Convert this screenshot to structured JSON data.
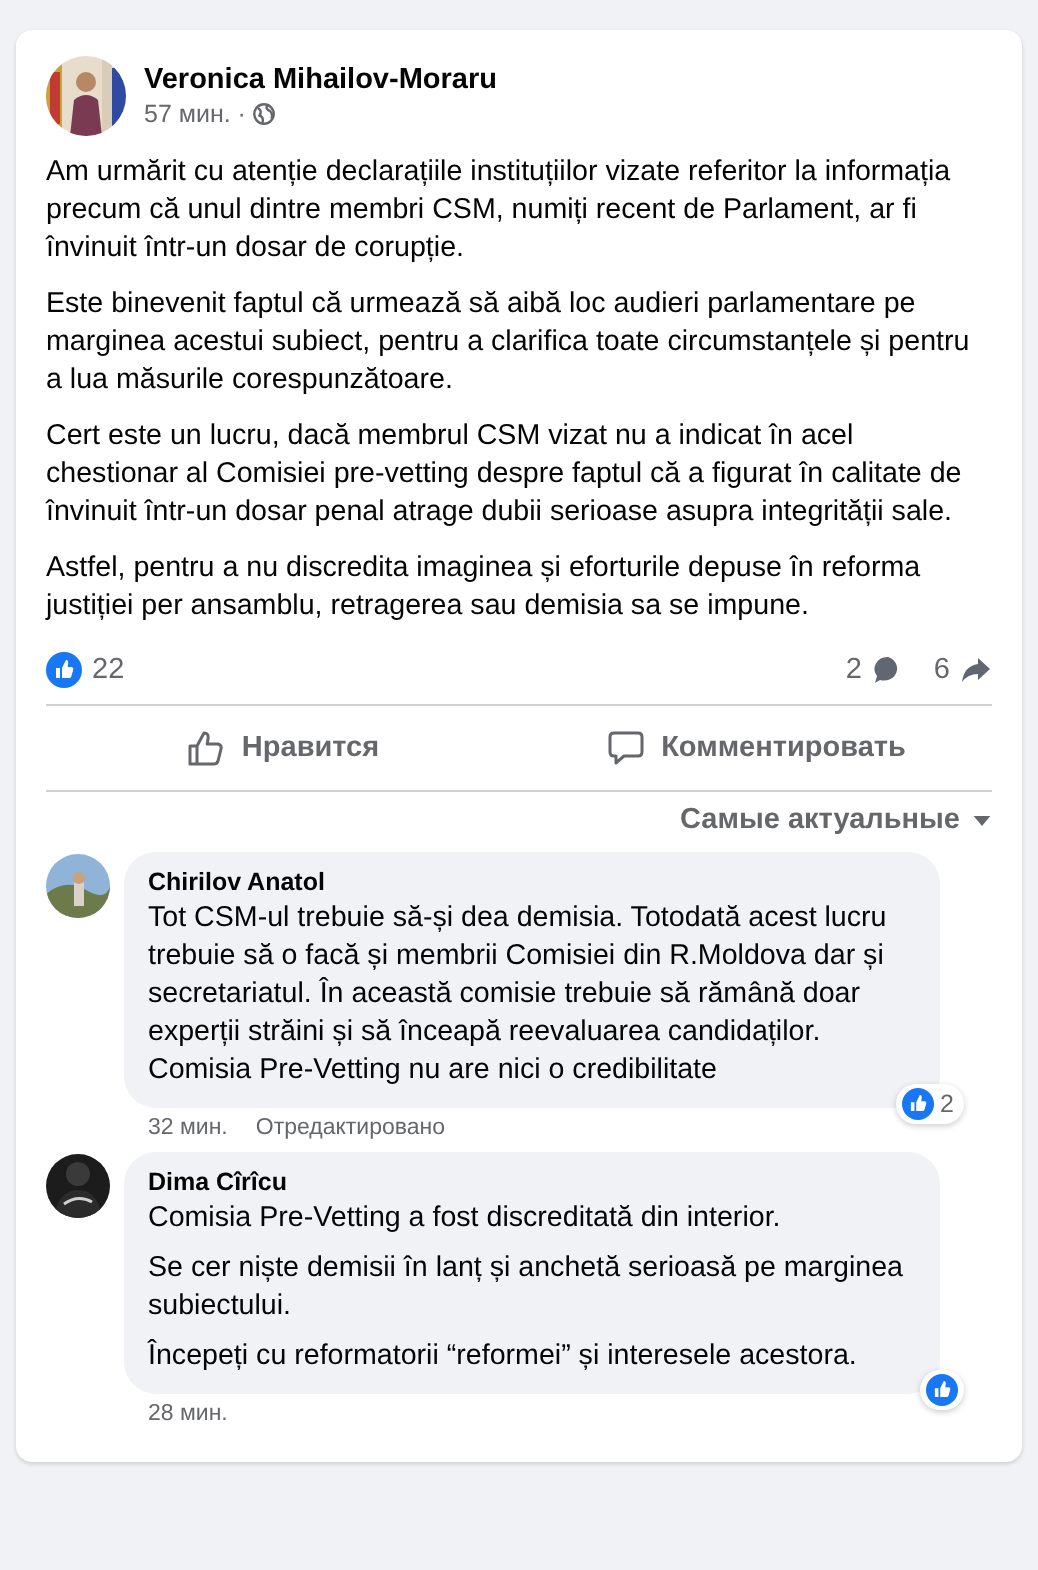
{
  "post": {
    "author": "Veronica Mihailov-Moraru",
    "time": "57 мин. ·",
    "paragraphs": [
      "Am urmărit cu atenție declarațiile instituțiilor vizate referitor la informația precum că unul dintre membri CSM, numiți recent de Parlament, ar fi învinuit într-un dosar de corupție.",
      "Este binevenit faptul că urmează să aibă loc audieri parlamentare pe marginea acestui subiect, pentru a clarifica toate circumstanțele și pentru a lua măsurile corespunzătoare.",
      "Cert este un lucru, dacă membrul CSM vizat nu a indicat în acel chestionar al Comisiei pre-vetting despre faptul că a figurat în calitate de învinuit într-un dosar penal atrage dubii serioase asupra integrității sale.",
      "Astfel, pentru a nu discredita imaginea și eforturile depuse în reforma justiției per ansamblu, retragerea sau demisia sa se impune."
    ],
    "reactions": "22",
    "comments_count": "2",
    "shares_count": "6"
  },
  "actions": [
    {
      "kind": "like",
      "label": "Нравится"
    },
    {
      "kind": "comment",
      "label": "Комментировать"
    }
  ],
  "sort": "Самые актуальные",
  "comments": [
    {
      "author": "Chirilov Anatol",
      "paragraphs": [
        "Tot CSM-ul trebuie să-și dea demisia. Totodată acest lucru trebuie să o facă și membrii Comisiei din R.Moldova dar și secretariatul. În această comisie trebuie să rămână doar experții străini și să înceapă reevaluarea candidaților. Comisia Pre-Vetting nu are nici o credibilitate"
      ],
      "time": "32 мин.",
      "edited": "Отредактировано",
      "likes": "2"
    },
    {
      "author": "Dima Cîrîcu",
      "paragraphs": [
        "Comisia Pre-Vetting a fost discreditată din interior.",
        "Se cer niște demisii în lanț și anchetă serioasă pe marginea subiectului.",
        "Începeți cu reformatorii “reformei” și interesele acestora."
      ],
      "time": "28 мин."
    }
  ]
}
